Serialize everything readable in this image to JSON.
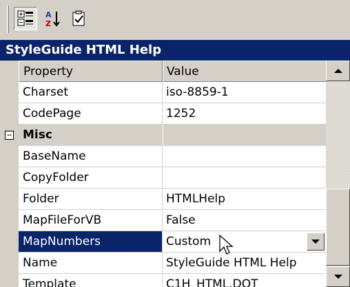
{
  "toolbar": {
    "buttons": [
      {
        "icon": "categorized-icon",
        "pressed": true
      },
      {
        "icon": "alphabetical-sort-icon",
        "pressed": false
      },
      {
        "icon": "property-pages-icon",
        "pressed": false
      }
    ]
  },
  "object_title": "StyleGuide HTML Help",
  "grid": {
    "headers": {
      "property": "Property",
      "value": "Value"
    },
    "rows": [
      {
        "property": "Charset",
        "value": "iso-8859-1"
      },
      {
        "property": "CodePage",
        "value": "1252"
      },
      {
        "property": "Misc",
        "value": "",
        "category": true,
        "expander": "⊟"
      },
      {
        "property": "BaseName",
        "value": ""
      },
      {
        "property": "CopyFolder",
        "value": ""
      },
      {
        "property": "Folder",
        "value": "HTMLHelp"
      },
      {
        "property": "MapFileForVB",
        "value": "False"
      },
      {
        "property": "MapNumbers",
        "value": "Custom",
        "selected": true
      },
      {
        "property": "Name",
        "value": "StyleGuide HTML Help"
      },
      {
        "property": "Template",
        "value": "C1H_HTML.DOT"
      }
    ]
  },
  "colors": {
    "selection": "#0a246a",
    "face": "#d4d0c8"
  }
}
